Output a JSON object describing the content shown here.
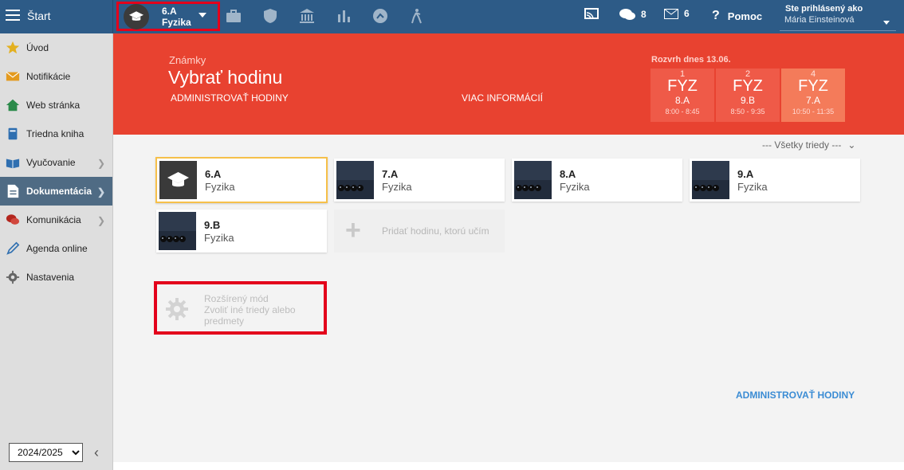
{
  "topbar": {
    "start_label": "Štart",
    "class_switch": {
      "class": "6.A",
      "subject": "Fyzika"
    },
    "messages_count": "8",
    "mail_count": "6",
    "help_label": "Pomoc",
    "logged_in_label": "Ste prihlásený ako",
    "user_name": "Mária Einsteinová"
  },
  "sidebar": {
    "items": [
      {
        "label": "Úvod",
        "icon": "star-icon"
      },
      {
        "label": "Notifikácie",
        "icon": "envelope-icon"
      },
      {
        "label": "Web stránka",
        "icon": "home-icon"
      },
      {
        "label": "Triedna kniha",
        "icon": "book-icon"
      },
      {
        "label": "Vyučovanie",
        "icon": "open-book-icon"
      },
      {
        "label": "Dokumentácia",
        "icon": "document-icon"
      },
      {
        "label": "Komunikácia",
        "icon": "chat-icon"
      },
      {
        "label": "Agenda online",
        "icon": "pen-icon"
      },
      {
        "label": "Nastavenia",
        "icon": "gear-icon"
      }
    ],
    "active_item": "Dokumentácia",
    "year": "2024/2025"
  },
  "hero": {
    "subtitle": "Známky",
    "title": "Vybrať hodinu",
    "admin_link": "ADMINISTROVAŤ HODINY",
    "more_info_link": "VIAC INFORMÁCIÍ",
    "schedule_label": "Rozvrh dnes 13.06.",
    "lessons": [
      {
        "num": "1",
        "subject": "FYZ",
        "class": "8.A",
        "time": "8:00 - 8:45"
      },
      {
        "num": "2",
        "subject": "FYZ",
        "class": "9.B",
        "time": "8:50 - 9:35"
      },
      {
        "num": "4",
        "subject": "FYZ",
        "class": "7.A",
        "time": "10:50 - 11:35"
      }
    ]
  },
  "content": {
    "filter_label": "--- Všetky triedy ---",
    "cards": [
      {
        "class": "6.A",
        "subject": "Fyzika"
      },
      {
        "class": "7.A",
        "subject": "Fyzika"
      },
      {
        "class": "8.A",
        "subject": "Fyzika"
      },
      {
        "class": "9.A",
        "subject": "Fyzika"
      },
      {
        "class": "9.B",
        "subject": "Fyzika"
      }
    ],
    "add_label": "Pridať hodinu, ktorú učím",
    "extended_mode_title": "Rozšírený mód",
    "extended_mode_desc": "Zvoliť iné triedy alebo predmety",
    "admin_link_bottom": "ADMINISTROVAŤ HODINY"
  },
  "colors": {
    "topbar": "#2d5b87",
    "hero": "#e84230",
    "highlight_border": "#e3001b",
    "selected_card_border": "#f6c04a",
    "link_blue": "#3b8cd4"
  }
}
